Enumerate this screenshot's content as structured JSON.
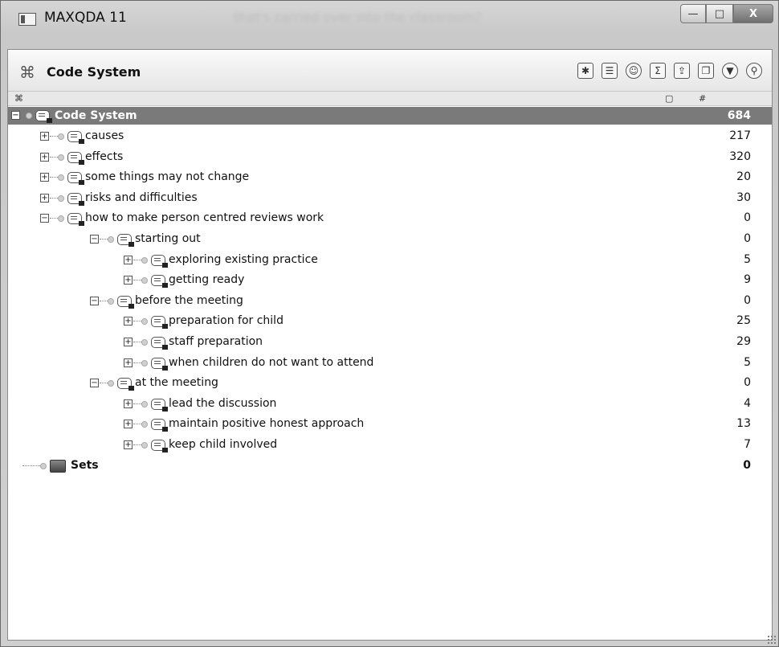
{
  "window": {
    "title": "MAXQDA 11",
    "blurred_text": "that's carried over into the classroom?",
    "controls": {
      "minimize": "—",
      "maximize": "□",
      "close": "X"
    }
  },
  "panel": {
    "title": "Code System",
    "toolbar_icons": [
      "activate-icon",
      "memo-icon",
      "emoticon-icon",
      "code-frequency-icon",
      "export-icon",
      "window-icon",
      "filter-icon",
      "search-icon"
    ],
    "column_header": {
      "color_col": "▢",
      "count_col": "#"
    }
  },
  "tree": {
    "root": {
      "label": "Code System",
      "count": "684"
    },
    "items": [
      {
        "label": "causes",
        "count": "217",
        "level": 1,
        "expander": "+"
      },
      {
        "label": "effects",
        "count": "320",
        "level": 1,
        "expander": "+"
      },
      {
        "label": "some things may not change",
        "count": "20",
        "level": 1,
        "expander": "+"
      },
      {
        "label": "risks and difficulties",
        "count": "30",
        "level": 1,
        "expander": "+"
      },
      {
        "label": "how to make person centred reviews work",
        "count": "0",
        "level": 1,
        "expander": "−"
      },
      {
        "label": "starting out",
        "count": "0",
        "level": 2,
        "expander": "−"
      },
      {
        "label": "exploring existing practice",
        "count": "5",
        "level": 3,
        "expander": "+"
      },
      {
        "label": "getting ready",
        "count": "9",
        "level": 3,
        "expander": "+"
      },
      {
        "label": "before the meeting",
        "count": "0",
        "level": 2,
        "expander": "−"
      },
      {
        "label": "preparation for child",
        "count": "25",
        "level": 3,
        "expander": "+"
      },
      {
        "label": "staff preparation",
        "count": "29",
        "level": 3,
        "expander": "+"
      },
      {
        "label": "when children do not want to attend",
        "count": "5",
        "level": 3,
        "expander": "+"
      },
      {
        "label": "at the meeting",
        "count": "0",
        "level": 2,
        "expander": "−"
      },
      {
        "label": "lead the discussion",
        "count": "4",
        "level": 3,
        "expander": "+"
      },
      {
        "label": "maintain positive honest approach",
        "count": "13",
        "level": 3,
        "expander": "+"
      },
      {
        "label": "keep child involved",
        "count": "7",
        "level": 3,
        "expander": "+"
      }
    ],
    "sets": {
      "label": "Sets",
      "count": "0"
    }
  }
}
